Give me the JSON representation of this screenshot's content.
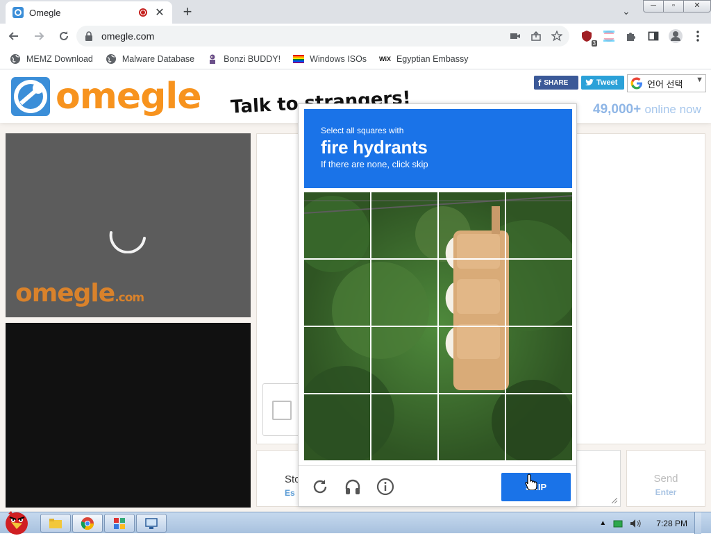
{
  "browser": {
    "tab_title": "Omegle",
    "url": "omegle.com",
    "window_buttons": {
      "minimize": "─",
      "maximize": "▫",
      "close": "✕"
    },
    "extension_badge": "3",
    "bookmarks": [
      {
        "label": "MEMZ Download",
        "icon": "globe-icon"
      },
      {
        "label": "Malware Database",
        "icon": "globe-icon"
      },
      {
        "label": "Bonzi BUDDY!",
        "icon": "bonzi-icon"
      },
      {
        "label": "Windows ISOs",
        "icon": "rainbow-flag-icon"
      },
      {
        "label": "Egyptian Embassy",
        "icon": "wix-icon"
      }
    ],
    "wix_text": "WiX"
  },
  "site": {
    "logo_text": "omegle",
    "tagline": "Talk to strangers!",
    "share": {
      "facebook": "SHARE",
      "twitter": "Tweet"
    },
    "translate": {
      "label": "언어 선택",
      "arrow": "▼"
    },
    "online_count": "49,000+",
    "online_label": "online now",
    "video_logo": "omegle",
    "video_logo_suffix": ".com",
    "stop_label": "Sto",
    "stop_key": "Es",
    "send_label": "Send",
    "send_key": "Enter"
  },
  "captcha": {
    "line1": "Select all squares with",
    "target": "fire hydrants",
    "line3": "If there are none, click skip",
    "skip_label": "SKIP",
    "grid_rows": 4,
    "grid_cols": 4
  },
  "taskbar": {
    "time": "7:28 PM"
  },
  "colors": {
    "accent_blue": "#1a73e8",
    "omegle_orange": "#f7931e",
    "facebook": "#3b5998",
    "twitter": "#2ba1d8"
  }
}
